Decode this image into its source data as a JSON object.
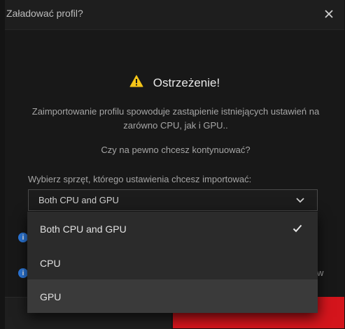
{
  "dialog": {
    "title": "Załadować profil?",
    "close_icon": "close-icon"
  },
  "warning": {
    "icon": "warning-icon",
    "icon_color": "#f5c518",
    "title": "Ostrzeżenie!"
  },
  "message": {
    "line1": "Zaimportowanie profilu spowoduje zastąpienie istniejących ustawień na",
    "line2": "zarówno CPU, jak i GPU..",
    "question": "Czy na pewno chcesz kontynuować?"
  },
  "hardware_select": {
    "label": "Wybierz sprzęt, którego ustawienia chcesz importować:",
    "selected": "Both CPU and GPU",
    "options": [
      {
        "label": "Both CPU and GPU",
        "checked": true
      },
      {
        "label": "CPU",
        "checked": false
      },
      {
        "label": "GPU",
        "checked": false
      }
    ]
  },
  "peek": {
    "right_text": "w"
  },
  "colors": {
    "accent_red": "#d4151c",
    "info_blue": "#2d7be0"
  }
}
